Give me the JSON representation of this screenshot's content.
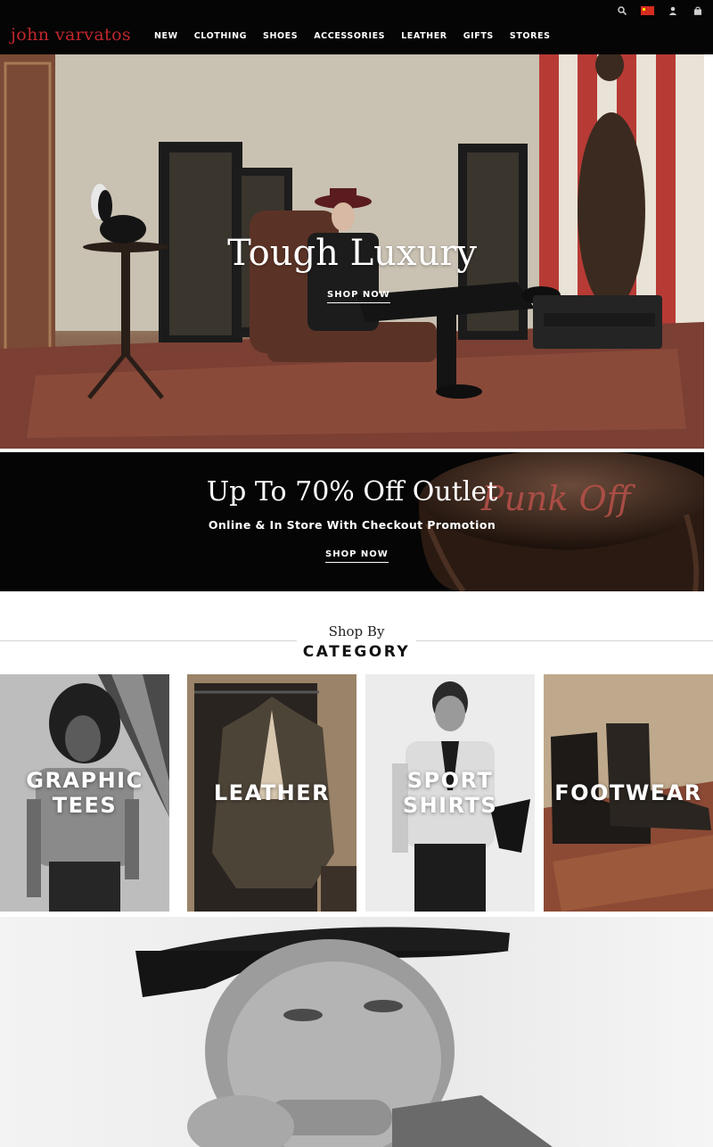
{
  "header": {
    "logo": "john varvatos",
    "nav": [
      "NEW",
      "CLOTHING",
      "SHOES",
      "ACCESSORIES",
      "LEATHER",
      "GIFTS",
      "STORES"
    ],
    "utility_icons": [
      "search-icon",
      "flag-icon",
      "account-icon",
      "bag-icon"
    ],
    "flag_color": "#d52b1e"
  },
  "hero": {
    "title": "Tough Luxury",
    "cta": "SHOP NOW"
  },
  "outlet": {
    "title": "Up To 70% Off Outlet",
    "subtitle": "Online & In Store With Checkout Promotion",
    "cta": "SHOP NOW",
    "script_text": "Punk Off"
  },
  "category_section": {
    "heading_top": "Shop By",
    "heading_bottom": "CATEGORY",
    "tiles": [
      {
        "label": "GRAPHIC\nTEES"
      },
      {
        "label": "LEATHER"
      },
      {
        "label": "SPORT\nSHIRTS"
      },
      {
        "label": "FOOTWEAR"
      }
    ]
  },
  "colors": {
    "brand_red": "#c0272d",
    "header_bg": "#050505"
  }
}
